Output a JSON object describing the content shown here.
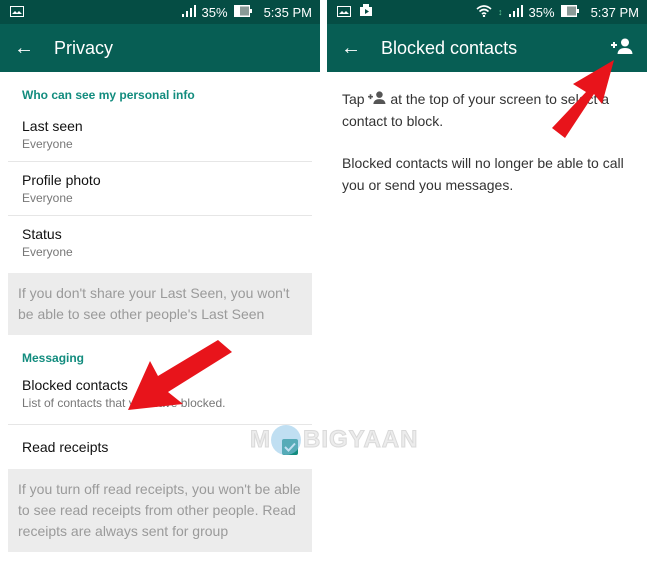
{
  "left_screen": {
    "status_bar": {
      "signal": "signal-icon",
      "battery_pct": "35%",
      "time": "5:35 PM"
    },
    "app_bar": {
      "title": "Privacy"
    },
    "sections": [
      {
        "header": "Who can see my personal info",
        "items": [
          {
            "label": "Last seen",
            "value": "Everyone"
          },
          {
            "label": "Profile photo",
            "value": "Everyone"
          },
          {
            "label": "Status",
            "value": "Everyone"
          }
        ],
        "note": "If you don't share your Last Seen, you won't be able to see other people's Last Seen"
      },
      {
        "header": "Messaging",
        "blocked": {
          "label": "Blocked contacts",
          "description": "List of contacts that you have blocked."
        },
        "read_receipts": {
          "label": "Read receipts",
          "checked": true
        },
        "note": "If you turn off read receipts, you won't be able to see read receipts from other people. Read receipts are always sent for group"
      }
    ]
  },
  "right_screen": {
    "status_bar": {
      "battery_pct": "35%",
      "time": "5:37 PM"
    },
    "app_bar": {
      "title": "Blocked contacts",
      "action_icon": "add-contact-icon"
    },
    "para1_before": "Tap",
    "para1_after": "at the top of your screen to select a contact to block.",
    "para2": "Blocked contacts will no longer be able to call you or send you messages."
  },
  "watermark": {
    "text": "BIGYAAN",
    "prefix": "M"
  },
  "colors": {
    "status_bar": "#054d44",
    "app_bar": "#075e54",
    "accent": "#128c7e",
    "arrow": "#e8141b"
  }
}
